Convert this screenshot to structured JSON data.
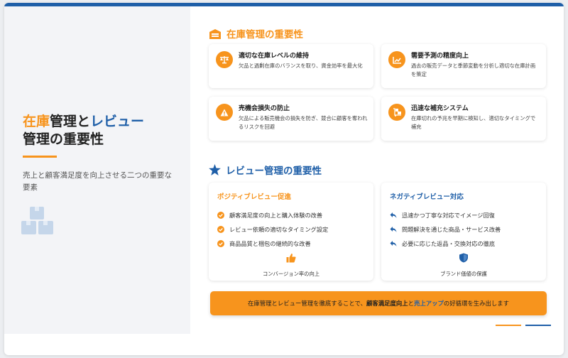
{
  "slide": {
    "title_part1": "在庫",
    "title_part2": "管理と",
    "title_part3": "レビュー",
    "title_part4": "管理の重要性",
    "subtitle": "売上と顧客満足度を向上させる二つの重要な要素",
    "left_icon": "boxes-icon"
  },
  "inventory": {
    "heading": "在庫管理の重要性",
    "heading_icon": "warehouse-icon",
    "cards": [
      {
        "icon": "scale-icon",
        "title": "適切な在庫レベルの維持",
        "desc": "欠品と過剰在庫のバランスを取り、資金効率を最大化"
      },
      {
        "icon": "chart-icon",
        "title": "需要予測の精度向上",
        "desc": "過去の販売データと季節変動を分析し適切な在庫計画を策定"
      },
      {
        "icon": "warning-icon",
        "title": "売機会損失の防止",
        "desc": "欠品による販売機会の損失を防ぎ、競合に顧客を奪われるリスクを回避"
      },
      {
        "icon": "dolly-icon",
        "title": "迅速な補充システム",
        "desc": "在庫切れの予兆を早期に検知し、適切なタイミングで補充"
      }
    ]
  },
  "review": {
    "heading": "レビュー管理の重要性",
    "heading_icon": "star-icon",
    "positive": {
      "title": "ポジティブレビュー促進",
      "items": [
        "顧客満足度の向上と購入体験の改善",
        "レビュー依頼の適切なタイミング設定",
        "商品品質と梱包の継続的な改善"
      ],
      "footer": "コンバージョン率の向上",
      "footer_icon": "thumbs-up-icon"
    },
    "negative": {
      "title": "ネガティブレビュー対応",
      "items": [
        "迅速かつ丁寧な対応でイメージ回復",
        "問題解決を通じた商品・サービス改善",
        "必要に応じた返品・交換対応の徹底"
      ],
      "footer": "ブランド価値の保護",
      "footer_icon": "shield-icon"
    }
  },
  "banner": {
    "part1": "在庫管理とレビュー管理を徹底することで、",
    "part2": "顧客満足度向上",
    "part3": "と",
    "part4": "売上アップ",
    "part5": "の好循環を生み出します"
  },
  "colors": {
    "orange": "#f7941d",
    "blue": "#1f5fa8",
    "panel": "#f3f4f7"
  }
}
